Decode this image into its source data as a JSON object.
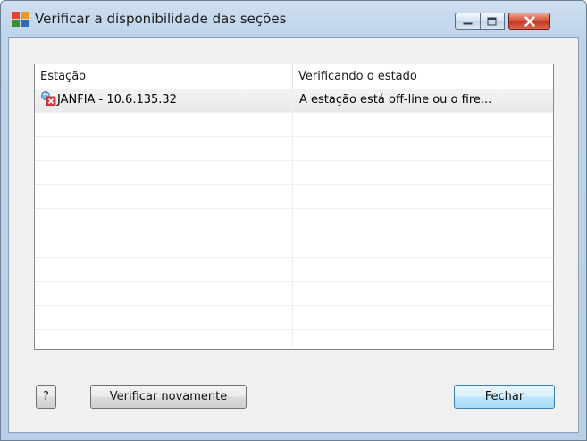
{
  "window": {
    "title": "Verificar a disponibilidade das seções",
    "app_icon": "avg-logo-icon",
    "controls": [
      "minimize-icon",
      "maximize-icon",
      "close-icon"
    ]
  },
  "list": {
    "columns": [
      "Estação",
      "Verificando o estado"
    ],
    "rows": [
      {
        "icon": "station-offline-icon",
        "station": "JANFIA - 10.6.135.32",
        "status": "A estação está off-line ou o fire..."
      }
    ],
    "empty_rows": 9
  },
  "buttons": {
    "help": "?",
    "recheck": "Verificar novamente",
    "close": "Fechar"
  },
  "colors": {
    "frame": "#b9cfe7",
    "close_button": "#c13a22",
    "default_button_border": "#3c7fb1"
  }
}
